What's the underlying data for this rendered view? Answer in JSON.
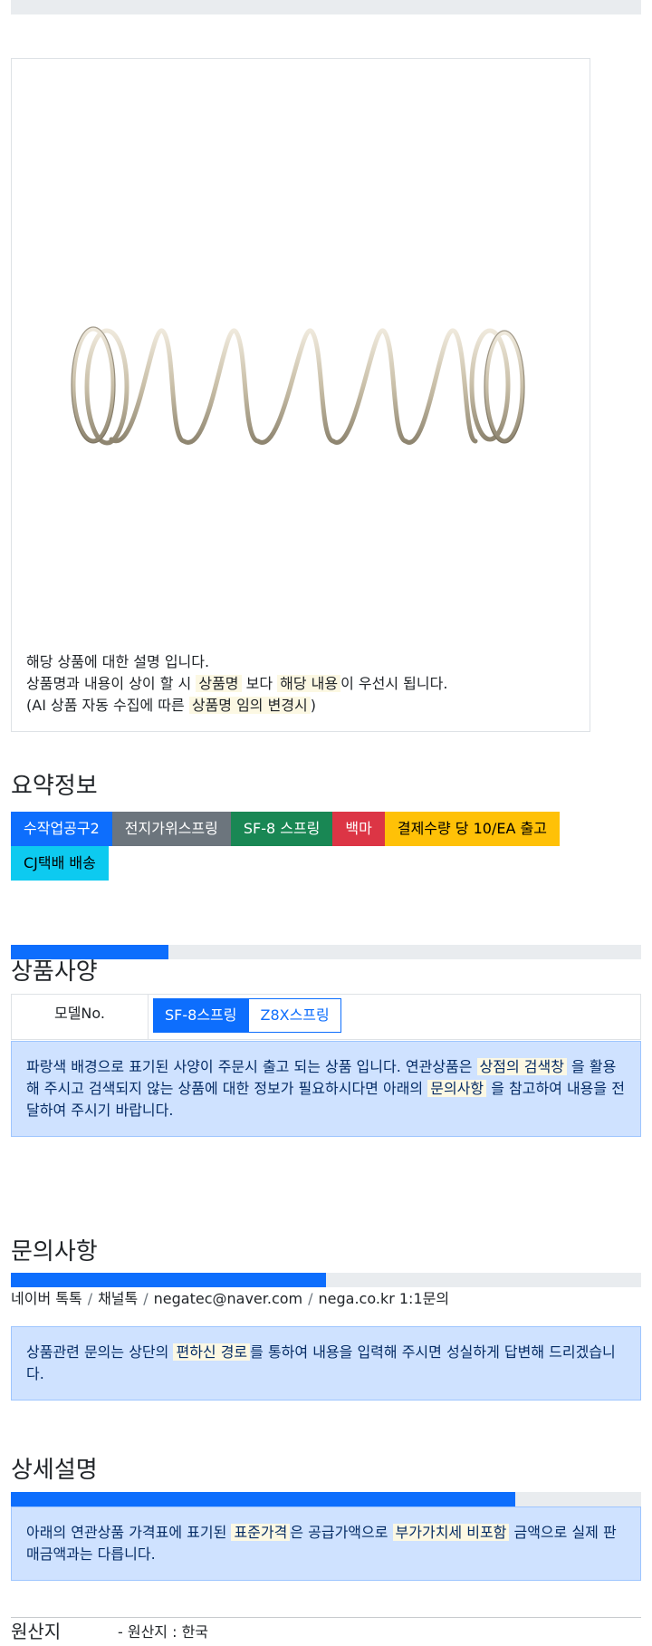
{
  "product_image": {
    "alt_icon": "coil-spring-image",
    "description": {
      "line1": "해당 상품에 대한 설명 입니다.",
      "line2_pre": "상품명과 내용이 상이 할 시 ",
      "line2_mark1": "상품명",
      "line2_mid": " 보다 ",
      "line2_mark2": "해당 내용",
      "line2_post": "이 우선시 됩니다.",
      "line3_pre": "(AI 상품 자동 수집에 따른 ",
      "line3_mark": "상품명 임의 변경시",
      "line3_post": ")"
    }
  },
  "summary": {
    "title": "요약정보",
    "badges": [
      {
        "label": "수작업공구2",
        "color": "#0d6efd",
        "text_color": "#ffffff"
      },
      {
        "label": "전지가위스프링",
        "color": "#6c757d",
        "text_color": "#ffffff"
      },
      {
        "label": "SF-8 스프링",
        "color": "#198754",
        "text_color": "#ffffff"
      },
      {
        "label": "백마",
        "color": "#dc3545",
        "text_color": "#ffffff"
      },
      {
        "label": "결제수량 당 10/EA 출고",
        "color": "#ffc107",
        "text_color": "#000000"
      },
      {
        "label": "CJ택배 배송",
        "color": "#0dcaf0",
        "text_color": "#000000"
      }
    ]
  },
  "spec": {
    "progress": 0.25,
    "title": "상품사양",
    "row_label": "모델No.",
    "options": [
      {
        "label": "SF-8스프링",
        "selected": true
      },
      {
        "label": "Z8X스프링",
        "selected": false
      }
    ],
    "notice": {
      "pre": "파랑색 배경으로 표기된 사양이 주문시 출고 되는 상품 입니다. 연관상품은 ",
      "mark1": "상점의 검색창",
      "mid": " 을 활용해 주시고 검색되지 않는 상품에 대한 정보가 필요하시다면 아래의 ",
      "mark2": "문의사항",
      "post": " 을 참고하여 내용을 전달하여 주시기 바랍니다."
    }
  },
  "inquiry": {
    "title": "문의사항",
    "progress": 0.5,
    "contacts": [
      "네이버 톡톡",
      "채널톡",
      "negatec@naver.com",
      "nega.co.kr 1:1문의"
    ],
    "separator": "/",
    "notice": {
      "pre": "상품관련 문의는 상단의 ",
      "mark": "편하신 경로",
      "post": "를 통하여 내용을 입력해 주시면 성실하게 답변해 드리겠습니다."
    }
  },
  "detail": {
    "title": "상세설명",
    "progress": 0.8,
    "notice": {
      "pre": "아래의 연관상품 가격표에 표기된 ",
      "mark1": "표준가격",
      "mid": "은 공급가액으로 ",
      "mark2": "부가가치세 비포함",
      "post": " 금액으로 실제 판매금액과는 다릅니다."
    }
  },
  "origin": {
    "label": "원산지",
    "value": "- 원산지 : 한국"
  }
}
